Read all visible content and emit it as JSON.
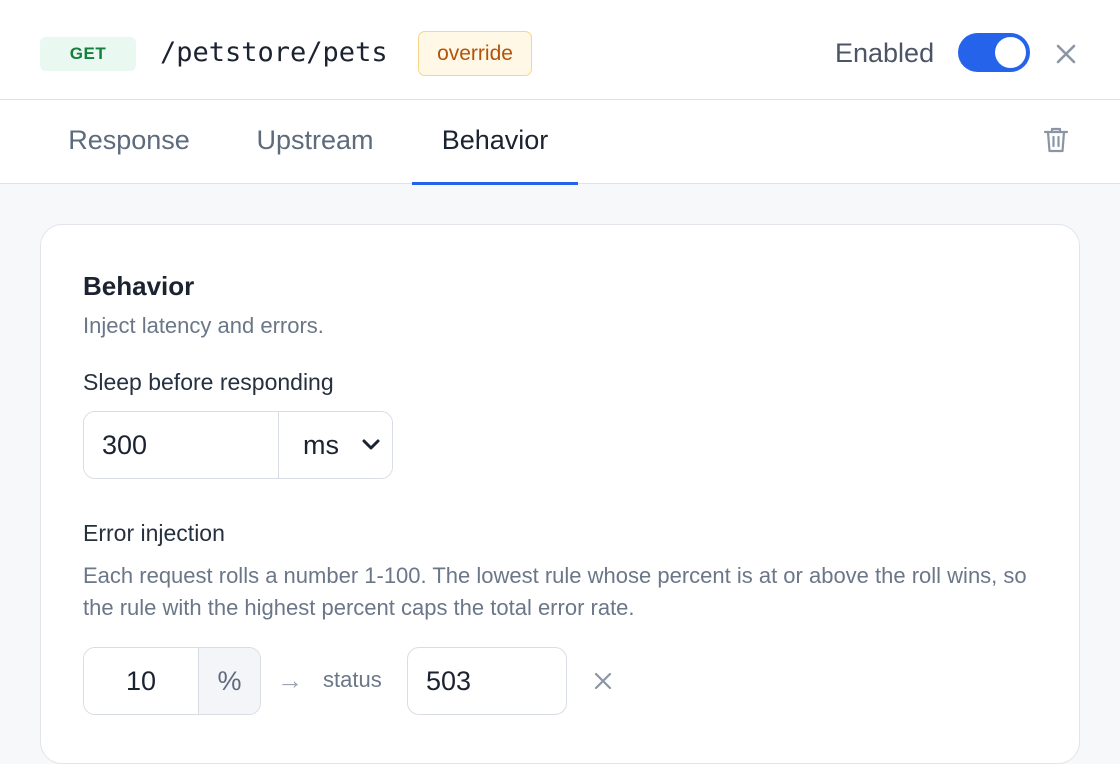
{
  "header": {
    "method": "GET",
    "path": "/petstore/pets",
    "badge": "override",
    "enabled_label": "Enabled",
    "enabled": true
  },
  "tabs": [
    {
      "label": "Response",
      "active": false
    },
    {
      "label": "Upstream",
      "active": false
    },
    {
      "label": "Behavior",
      "active": true
    }
  ],
  "behavior": {
    "title": "Behavior",
    "description": "Inject latency and errors.",
    "sleep": {
      "label": "Sleep before responding",
      "value": "300",
      "unit": "ms"
    },
    "error_injection": {
      "title": "Error injection",
      "help": "Each request rolls a number 1-100. The lowest rule whose percent is at or above the roll wins, so the rule with the highest percent caps the total error rate.",
      "rules": [
        {
          "percent": "10",
          "percent_suffix": "%",
          "arrow": "→",
          "status_label": "status",
          "status": "503"
        }
      ]
    }
  },
  "colors": {
    "accent": "#2563eb",
    "method_get": "#15803d",
    "override": "#b45309"
  },
  "icons": [
    "close-icon",
    "trash-icon",
    "chevron-down-icon",
    "remove-rule-icon"
  ]
}
